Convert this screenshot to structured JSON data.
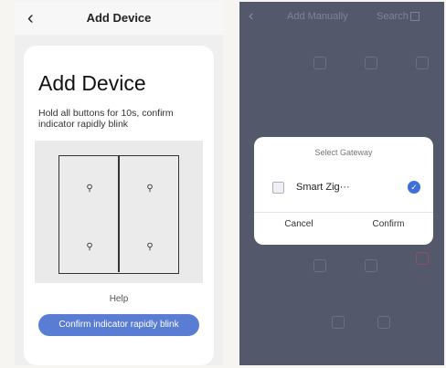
{
  "left": {
    "header": {
      "back_icon": "chevron-left-icon",
      "title": "Add Device"
    },
    "card": {
      "heading": "Add Device",
      "description": "Hold all buttons for 10s, confirm indicator rapidly blink",
      "illustration": {
        "switch_type": "4-gang switch",
        "bulb_icon": "bulb-icon",
        "bulb_glyph": "♀"
      },
      "help": "Help",
      "confirm_button": "Confirm indicator rapidly blink",
      "accent_color": "#5a7dd4"
    }
  },
  "right": {
    "header": {
      "back_icon": "chevron-left-icon",
      "title": "Add Manually",
      "search": "Search",
      "search_icon": "scan-icon"
    },
    "dialog": {
      "title": "Select Gateway",
      "gateway": {
        "name": "Smart Zig···",
        "selected": true,
        "check_icon": "check-circle-icon"
      },
      "cancel": "Cancel",
      "confirm": "Confirm",
      "accent_color": "#3f6fd8"
    }
  }
}
